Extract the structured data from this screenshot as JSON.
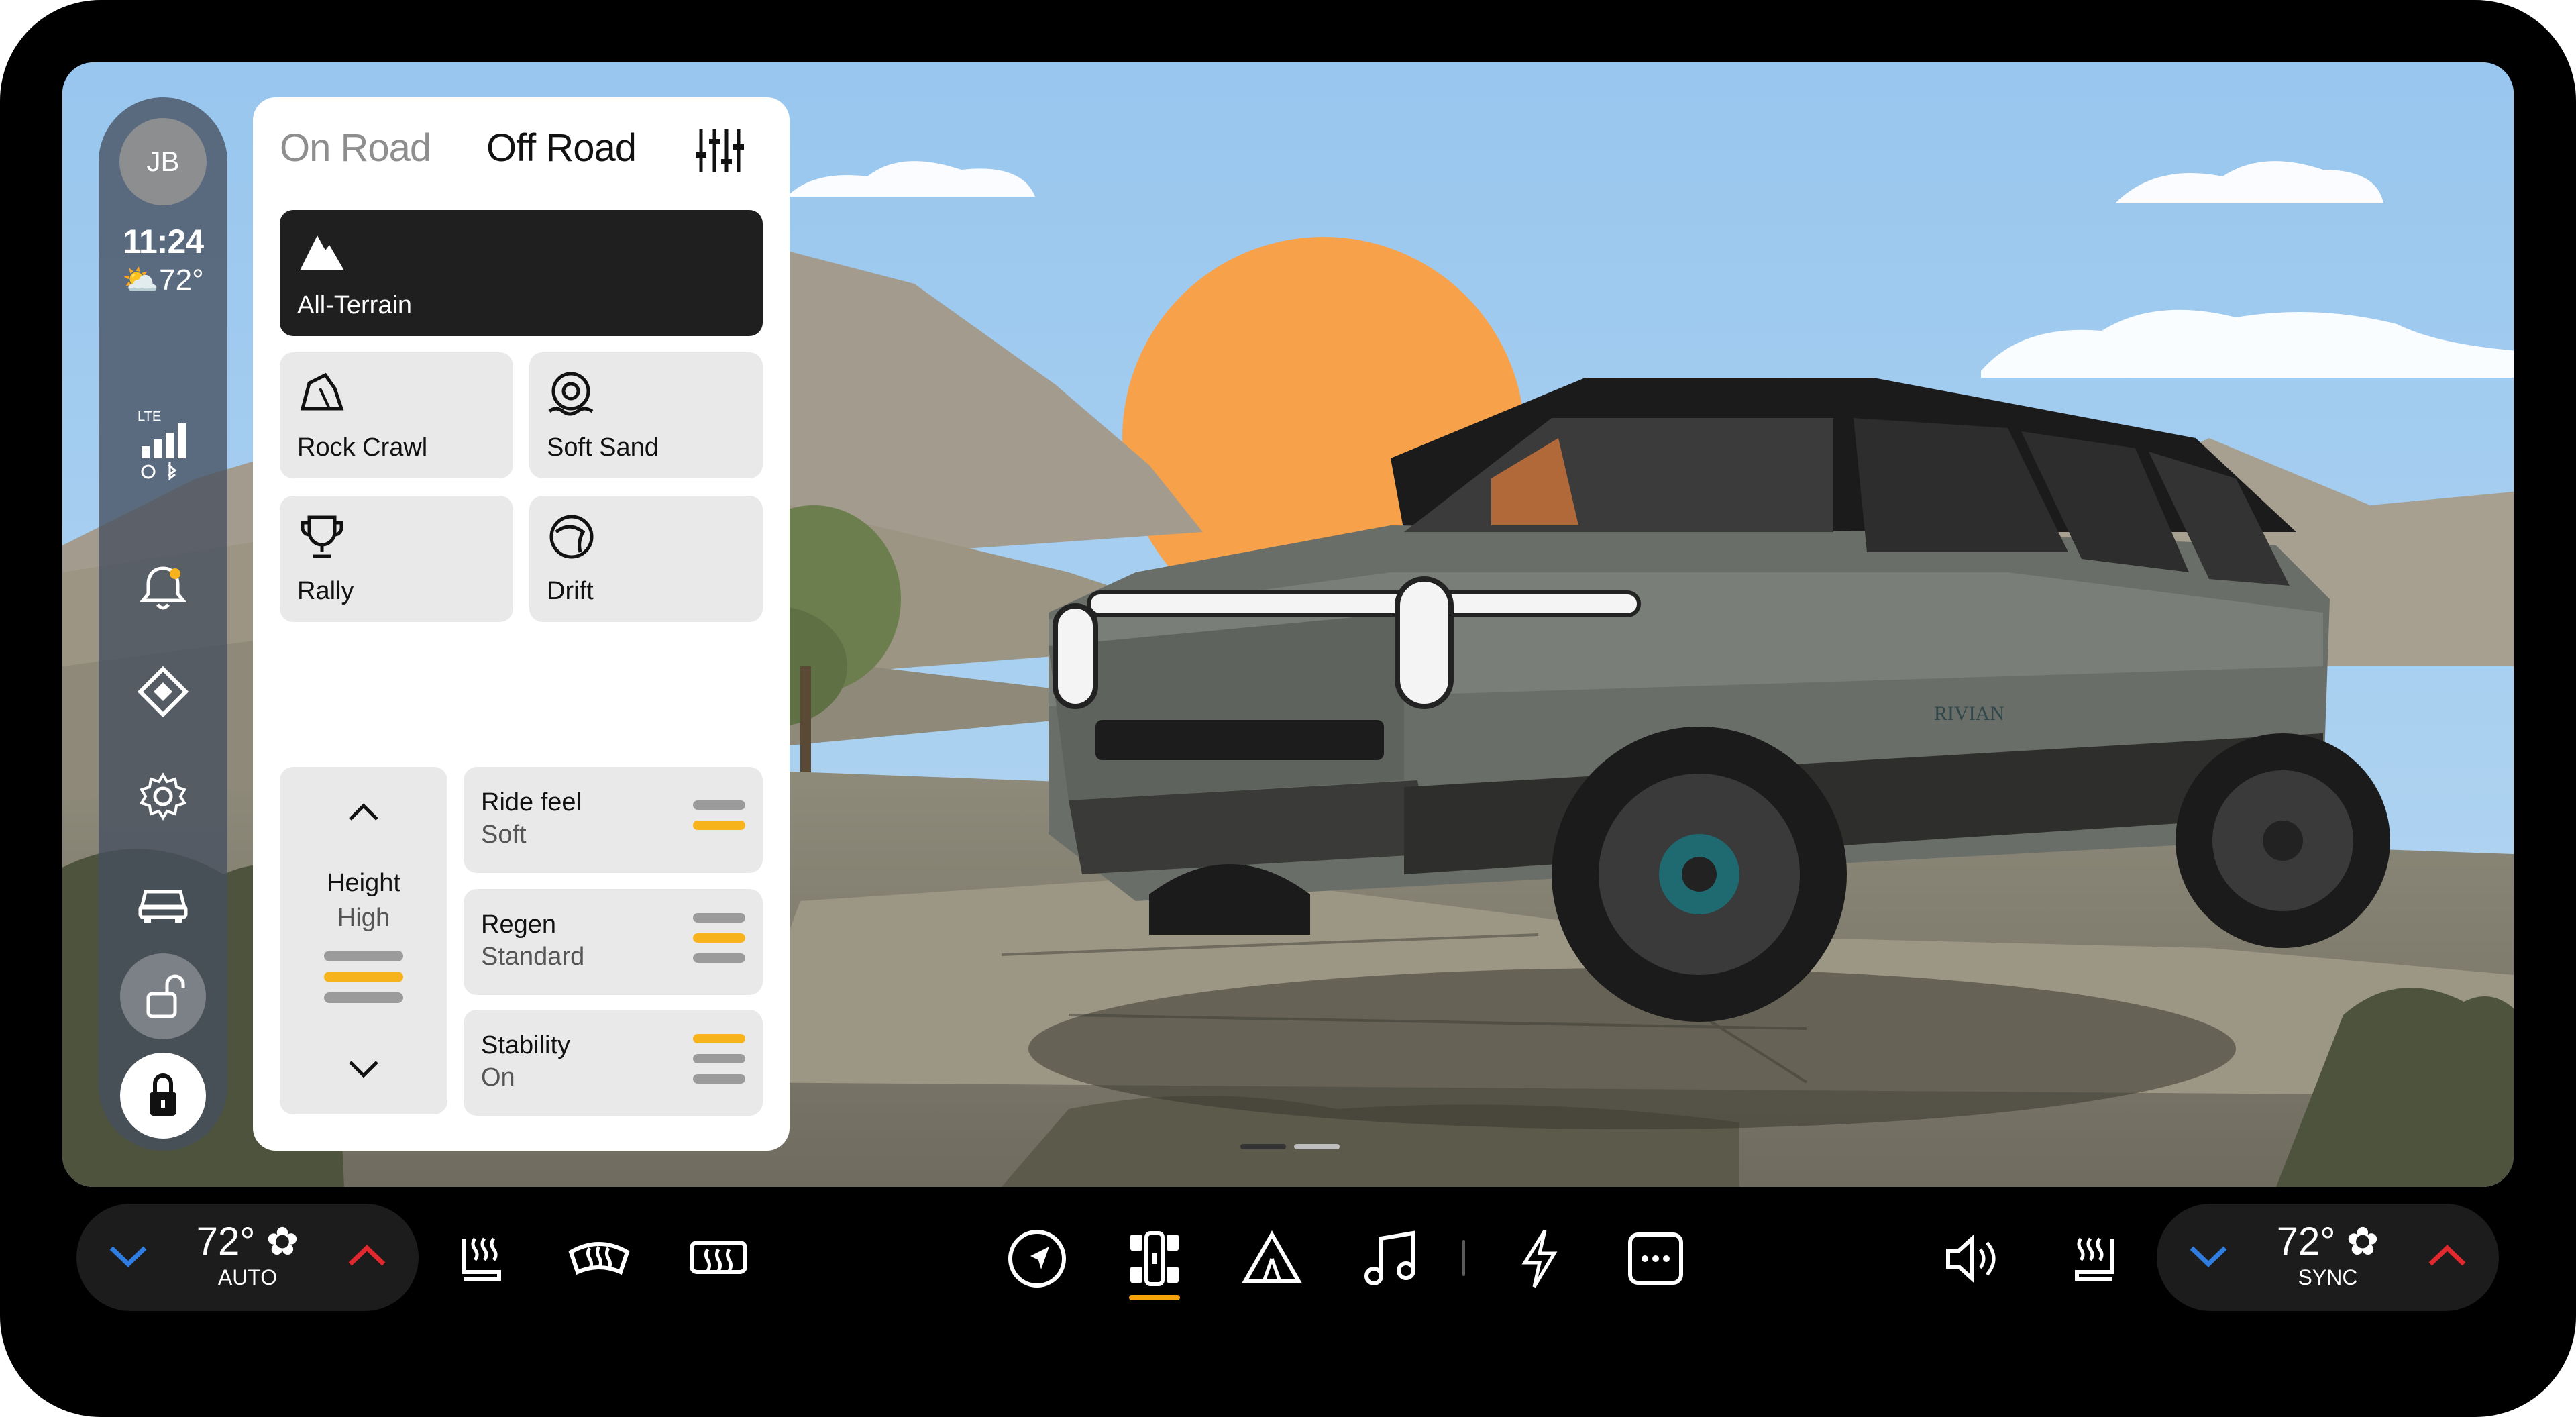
{
  "profile": {
    "initials": "JB"
  },
  "status": {
    "time": "11:24",
    "weather_temp": "72°",
    "network": "LTE"
  },
  "drive_modes": {
    "tabs": [
      {
        "label": "On Road",
        "selected": false
      },
      {
        "label": "Off Road",
        "selected": true
      }
    ],
    "modes": [
      {
        "label": "All-Terrain",
        "icon": "mountain-icon",
        "selected": true
      },
      {
        "label": "Rock Crawl",
        "icon": "rock-icon",
        "selected": false
      },
      {
        "label": "Soft Sand",
        "icon": "sand-icon",
        "selected": false
      },
      {
        "label": "Rally",
        "icon": "trophy-icon",
        "selected": false
      },
      {
        "label": "Drift",
        "icon": "drift-icon",
        "selected": false
      }
    ],
    "height": {
      "label": "Height",
      "value": "High",
      "level_index": 1,
      "levels": 3
    },
    "settings": [
      {
        "label": "Ride feel",
        "value": "Soft",
        "level_index": 1
      },
      {
        "label": "Regen",
        "value": "Standard",
        "level_index": 1
      },
      {
        "label": "Stability",
        "value": "On",
        "level_index": 0
      }
    ]
  },
  "pager": {
    "pages": 2,
    "current": 0
  },
  "climate": {
    "driver": {
      "temp": "72°",
      "mode": "AUTO"
    },
    "passenger": {
      "temp": "72°",
      "mode": "SYNC"
    }
  },
  "dock": {
    "active": "vehicle-icon",
    "icons": [
      "heated-seat-icon",
      "front-defrost-icon",
      "rear-defrost-icon",
      "navigation-icon",
      "vehicle-icon",
      "camp-icon",
      "music-icon",
      "energy-icon",
      "more-icon",
      "volume-icon",
      "passenger-seat-heat-icon"
    ]
  },
  "colors": {
    "accent": "#f6b31b",
    "temp_down": "#2f7de1",
    "temp_up": "#e0282e",
    "selected_card": "#1f1f1f",
    "sun": "#f7a24a"
  }
}
